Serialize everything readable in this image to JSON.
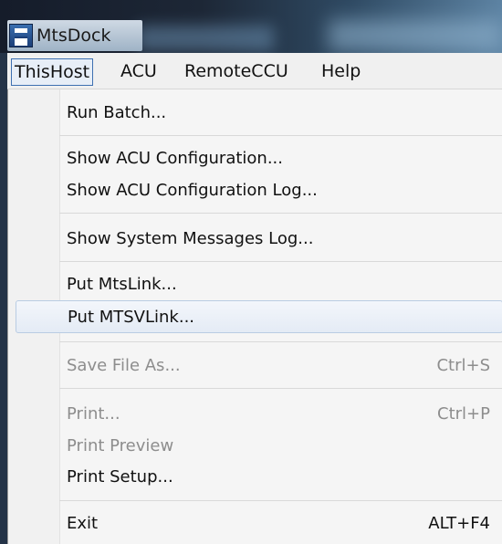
{
  "window": {
    "title": "MtsDock",
    "icon": "app-window-icon"
  },
  "menubar": {
    "items": [
      "ThisHost",
      "ACU",
      "RemoteCCU",
      "Help"
    ],
    "active": "ThisHost"
  },
  "dropdown": {
    "items": [
      {
        "label": "Run Batch..."
      },
      {
        "label": "Show ACU Configuration..."
      },
      {
        "label": "Show ACU Configuration Log..."
      },
      {
        "label": "Show System Messages Log..."
      },
      {
        "label": "Put MtsLink..."
      },
      {
        "label": "Put MTSVLink...",
        "state": "highlighted"
      },
      {
        "label": "Save File As...",
        "shortcut": "Ctrl+S",
        "state": "disabled"
      },
      {
        "label": "Print...",
        "shortcut": "Ctrl+P",
        "state": "disabled"
      },
      {
        "label": "Print Preview",
        "state": "disabled"
      },
      {
        "label": "Print Setup..."
      },
      {
        "label": "Exit",
        "shortcut": "ALT+F4"
      }
    ]
  },
  "colors": {
    "highlight_border": "#b9cce3",
    "disabled_text": "#8d8d8d",
    "menu_active_border": "#3e70b1"
  }
}
